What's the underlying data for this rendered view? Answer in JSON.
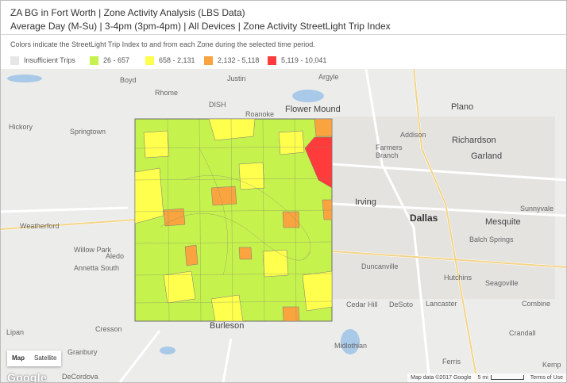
{
  "header": {
    "line1": "ZA BG in Fort Worth | Zone Activity Analysis (LBS Data)",
    "line2": "Average Day (M-Su) | 3-4pm (3pm-4pm) | All Devices | Zone Activity StreetLight Trip Index"
  },
  "legend": {
    "description": "Colors indicate the StreetLight Trip Index to and from each Zone during the selected time period.",
    "items": [
      {
        "label": "Insufficient Trips",
        "color": "#e6e6e6"
      },
      {
        "label": "26 - 657",
        "color": "#c6f24e"
      },
      {
        "label": "658 - 2,131",
        "color": "#ffff4d"
      },
      {
        "label": "2,132 - 5,118",
        "color": "#f9a43e"
      },
      {
        "label": "5,119 - 10,041",
        "color": "#ff3b3b"
      }
    ]
  },
  "map": {
    "places": {
      "boyd": "Boyd",
      "justin": "Justin",
      "argyle": "Argyle",
      "rhome": "Rhome",
      "roanoke": "Roanoke",
      "flower_mound": "Flower Mound",
      "plano": "Plano",
      "addison": "Addison",
      "richardson": "Richardson",
      "farmers_branch": "Farmers Branch",
      "garland": "Garland",
      "irving": "Irving",
      "dallas": "Dallas",
      "sunnyvale": "Sunnyvale",
      "mesquite": "Mesquite",
      "balch_springs": "Balch Springs",
      "duncanville": "Duncanville",
      "desoto": "DeSoto",
      "lancaster": "Lancaster",
      "hutchins": "Hutchins",
      "seagoville": "Seagoville",
      "cedar_hill": "Cedar Hill",
      "combine": "Combine",
      "crandall": "Crandall",
      "springtown": "Springtown",
      "weatherford": "Weatherford",
      "aledo": "Aledo",
      "willow_park": "Willow Park",
      "annetta_south": "Annetta South",
      "cresson": "Cresson",
      "granbury": "Granbury",
      "burleson": "Burleson",
      "midlothian": "Midlothian",
      "decordova": "DeCordova",
      "kemp": "Kemp",
      "ferris": "Ferris",
      "lipan": "Lipan",
      "dish": "DISH",
      "hickory": "Hickory"
    },
    "map_type": {
      "map": "Map",
      "satellite": "Satellite"
    },
    "logo": "Google",
    "attribution": {
      "map_data": "Map data ©2017 Google",
      "scale": "5 mi",
      "terms": "Terms of Use"
    }
  }
}
